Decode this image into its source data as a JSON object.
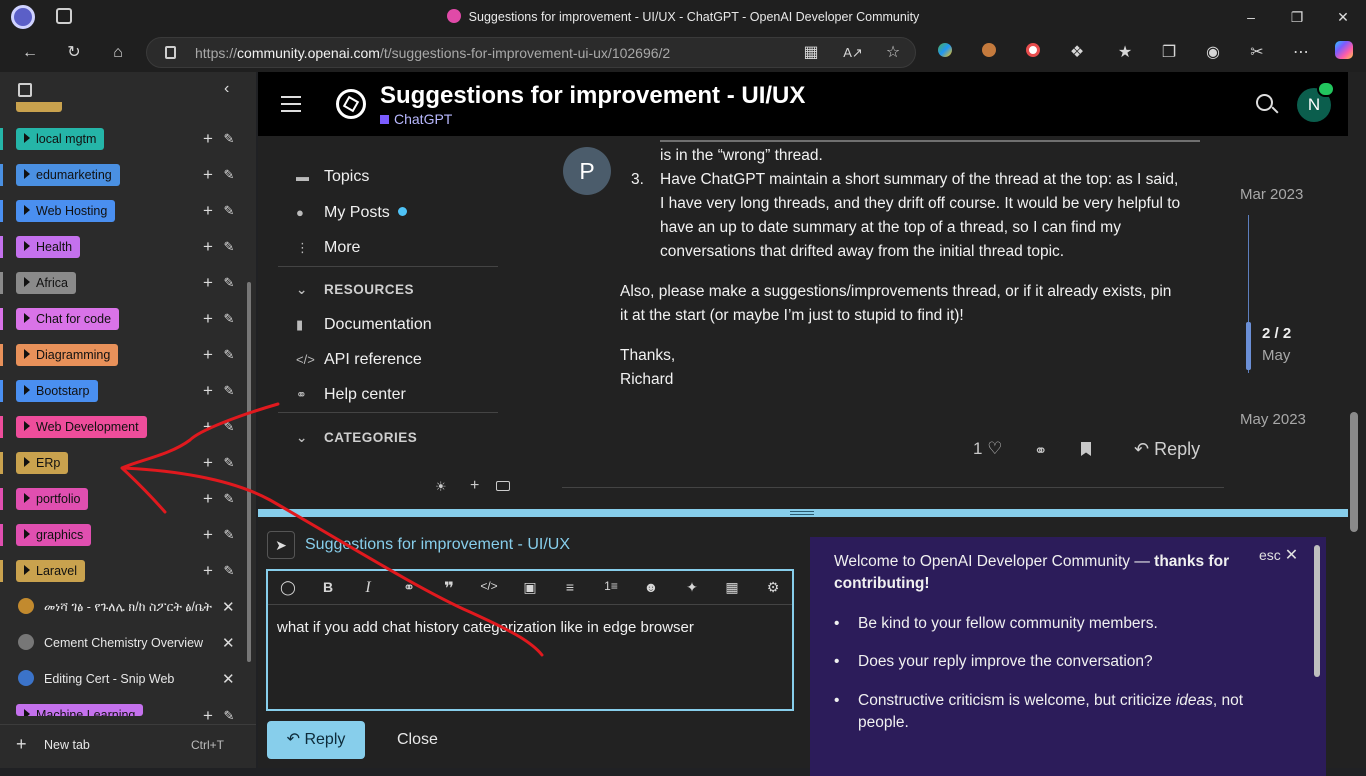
{
  "window": {
    "title": "Suggestions for improvement - UI/UX - ChatGPT - OpenAI Developer Community"
  },
  "toolbar": {
    "url_prefix": "https://",
    "url_domain": "community.openai.com",
    "url_path": "/t/suggestions-for-improvement-ui-ux/102696/2"
  },
  "sidebar": {
    "groups": [
      {
        "label": "local mgtm",
        "color": "#25b5a8"
      },
      {
        "label": "edumarketing",
        "color": "#4a90e2"
      },
      {
        "label": "Web Hosting",
        "color": "#4a8ff0"
      },
      {
        "label": "Health",
        "color": "#c471ed"
      },
      {
        "label": "Africa",
        "color": "#8a8a8a"
      },
      {
        "label": "Chat for code",
        "color": "#d973e8"
      },
      {
        "label": "Diagramming",
        "color": "#e8915a"
      },
      {
        "label": "Bootstarp",
        "color": "#4a8ff0"
      },
      {
        "label": "Web Development",
        "color": "#ee4d9b"
      },
      {
        "label": "ERp",
        "color": "#c9a24e"
      },
      {
        "label": "portfolio",
        "color": "#e04fb0"
      },
      {
        "label": "graphics",
        "color": "#e04fb0"
      },
      {
        "label": "Laravel",
        "color": "#c9a24e"
      }
    ],
    "tabs": [
      {
        "label": "መነሻ ገፅ - የጉለሌ ክ/ከ ስፖርት ፅ/ቤት",
        "icon_color": "#c28a2e"
      },
      {
        "label": "Cement Chemistry Overview",
        "icon_color": "#777777"
      },
      {
        "label": "Editing Cert - Snip Web",
        "icon_color": "#3b73c9"
      }
    ],
    "last_group": {
      "label": "Machine Learning",
      "color": "#c471ed"
    },
    "new_tab_label": "New tab",
    "new_tab_shortcut": "Ctrl+T"
  },
  "header": {
    "title": "Suggestions for improvement - UI/UX",
    "category": "ChatGPT",
    "avatar_letter": "N"
  },
  "nav": {
    "topics": "Topics",
    "my_posts": "My Posts",
    "more": "More",
    "resources_heading": "RESOURCES",
    "documentation": "Documentation",
    "api_reference": "API reference",
    "help_center": "Help center",
    "categories_heading": "CATEGORIES"
  },
  "post": {
    "avatar_letter": "P",
    "line_wrong_thread": "is in the “wrong” thread.",
    "item3_number": "3.",
    "item3_lines": [
      "Have ChatGPT maintain a short summary of the thread at the top: as I said,",
      "I have very long threads, and they drift off course. It would be very helpful to",
      "have an up to date summary at the top of a thread, so I can find my",
      "conversations that drifted away from the initial thread topic."
    ],
    "para_lines": [
      "Also, please make a suggestions/improvements thread, or if it already exists, pin",
      "it at the start (or maybe I’m just to stupid to find it)!"
    ],
    "thanks": "Thanks,",
    "signature": "Richard",
    "likes": "1",
    "reply_label": "Reply"
  },
  "timeline": {
    "start": "Mar 2023",
    "position": "2 / 2",
    "current": "May",
    "end": "May 2023"
  },
  "composer": {
    "topic_title": "Suggestions for improvement - UI/UX",
    "body_text": "what if you add chat history categorization like in edge browser",
    "reply_button": "Reply",
    "close_button": "Close"
  },
  "welcome": {
    "esc_label": "esc",
    "intro_normal": "Welcome to OpenAI Developer Community — ",
    "intro_bold": "thanks for contributing!",
    "bullet1": "Be kind to your fellow community members.",
    "bullet2": "Does your reply improve the conversation?",
    "bullet3_a": "Constructive criticism is welcome, but criticize ",
    "bullet3_em": "ideas",
    "bullet3_b": ", not people."
  }
}
